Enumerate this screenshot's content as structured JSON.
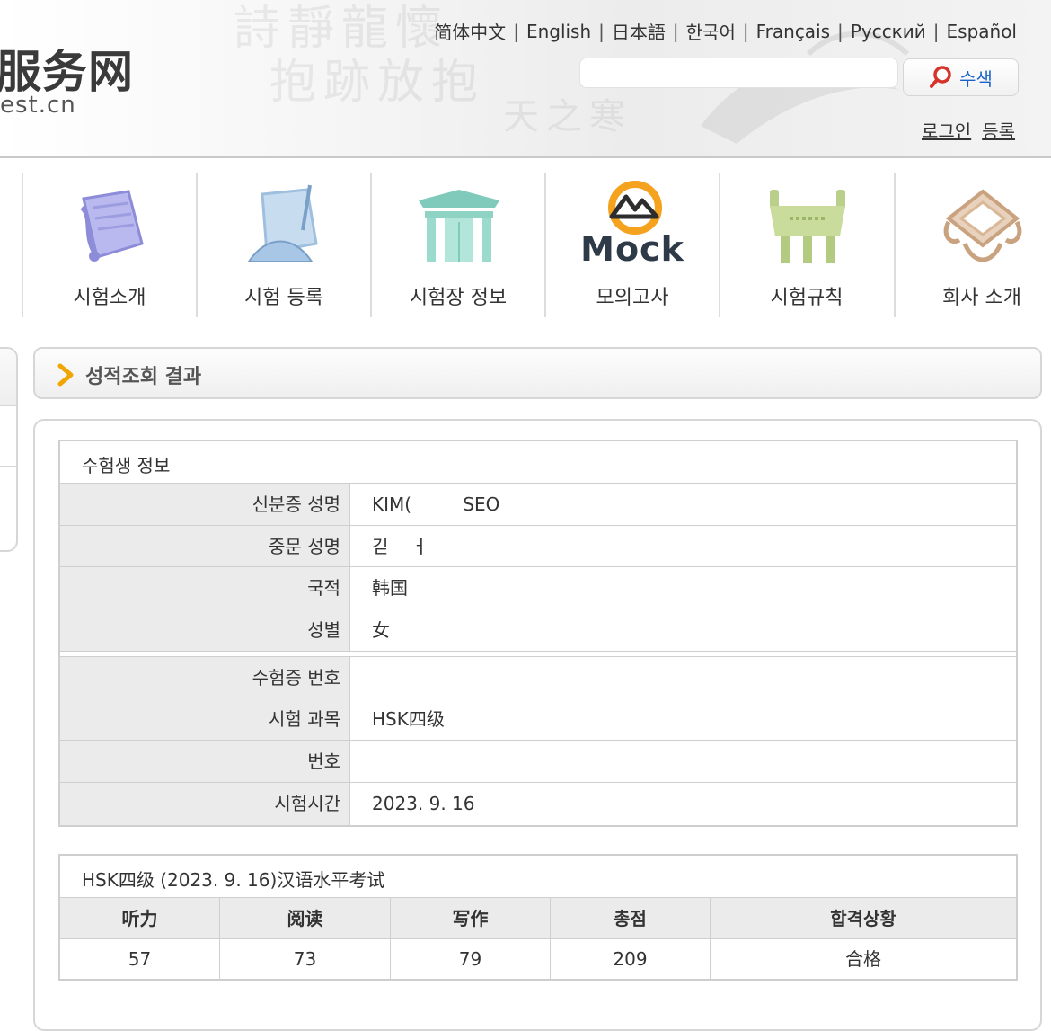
{
  "header": {
    "site_title": "服务网",
    "site_url": "est.cn",
    "languages": [
      "简体中文",
      "English",
      "日本語",
      "한국어",
      "Français",
      "Русский",
      "Español"
    ],
    "search": {
      "placeholder": "",
      "button_label": "수색"
    },
    "auth": {
      "login": "로그인",
      "register": "등록"
    }
  },
  "nav": [
    {
      "label": "시험소개",
      "icon": "scroll-icon"
    },
    {
      "label": "시험 등록",
      "icon": "brush-fan-icon"
    },
    {
      "label": "시험장 정보",
      "icon": "gate-icon"
    },
    {
      "label": "모의고사",
      "icon": "mock-logo-icon",
      "logo_text": "Mock"
    },
    {
      "label": "시험규칙",
      "icon": "tripod-cauldron-icon"
    },
    {
      "label": "회사 소개",
      "icon": "seal-icon"
    }
  ],
  "result": {
    "title": "성적조회 결과",
    "candidate": {
      "caption": "수험생 정보",
      "rows_a": [
        {
          "key": "신분증 성명",
          "value": "KIM(         SEO"
        },
        {
          "key": "중문 성명",
          "value": "긷    ㅓ"
        },
        {
          "key": "국적",
          "value": "韩国"
        },
        {
          "key": "성별",
          "value": "女"
        }
      ],
      "rows_b": [
        {
          "key": "수험증 번호",
          "value": ""
        },
        {
          "key": "시험 과목",
          "value": "HSK四级"
        },
        {
          "key": "번호",
          "value": ""
        },
        {
          "key": "시험시간",
          "value": "2023. 9. 16"
        }
      ]
    },
    "scores": {
      "caption": "HSK四级 (2023. 9. 16)汉语水平考试",
      "headers": [
        "听力",
        "阅读",
        "写作",
        "총점",
        "합격상황"
      ],
      "values": [
        "57",
        "73",
        "79",
        "209",
        "合格"
      ]
    }
  },
  "colors": {
    "search_text": "#1a62c9",
    "arrow": "#f0a500",
    "border": "#cfcfcf",
    "header_cell": "#ebebeb"
  }
}
